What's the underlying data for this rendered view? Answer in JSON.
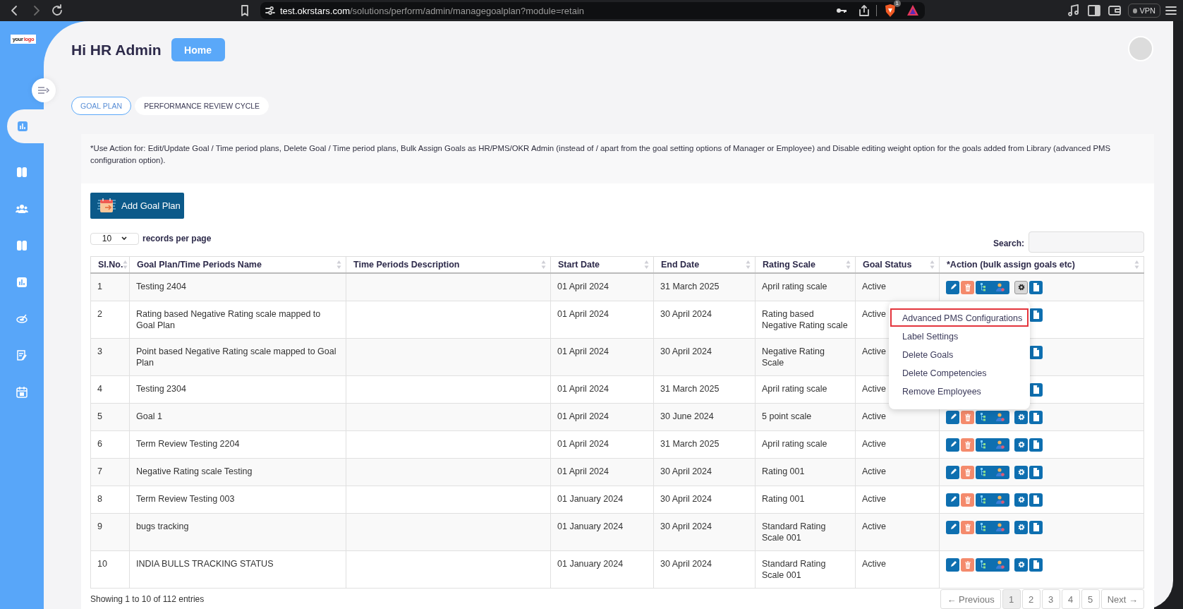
{
  "browser": {
    "url_host": "test.okrstars.com",
    "url_path": "/solutions/perform/admin/managegoalplan?module=retain",
    "shield_badge": "1",
    "vpn_label": "VPN"
  },
  "sidebar": {
    "logo": [
      "your",
      "logo"
    ],
    "items": [
      {
        "kind": "chart",
        "selected": true
      },
      {
        "kind": "book",
        "selected": false
      },
      {
        "kind": "team",
        "selected": false
      },
      {
        "kind": "book",
        "selected": false
      },
      {
        "kind": "chart",
        "selected": false
      },
      {
        "kind": "target",
        "selected": false
      },
      {
        "kind": "form",
        "selected": false
      },
      {
        "kind": "calendar",
        "selected": false
      }
    ]
  },
  "header": {
    "greeting": "Hi HR Admin",
    "home_button": "Home"
  },
  "tabs": [
    {
      "label": "GOAL PLAN",
      "selected": true
    },
    {
      "label": "PERFORMANCE REVIEW CYCLE",
      "selected": false
    }
  ],
  "note": "*Use Action for: Edit/Update Goal / Time period plans, Delete Goal / Time period plans, Bulk Assign Goals as HR/PMS/OKR Admin (instead of / apart from the goal setting options of Manager or Employee) and Disable editing weight option for the goals added from Library (advanced PMS configuration option).",
  "add_button": "Add Goal Plan",
  "page_size": {
    "value": "10",
    "label": "records per page"
  },
  "search": {
    "label": "Search:"
  },
  "table": {
    "columns": [
      "Sl.No.",
      "Goal Plan/Time Periods Name",
      "Time Periods Description",
      "Start Date",
      "End Date",
      "Rating Scale",
      "Goal Status",
      "*Action (bulk assign goals etc)"
    ],
    "rows": [
      {
        "no": "1",
        "name": "Testing 2404",
        "start_date": "01 April 2024",
        "end_date": "31 March 2025",
        "rating_scale": "April rating scale",
        "status": "Active",
        "actions": [
          {
            "kind": "edit"
          },
          {
            "kind": "delete"
          },
          {
            "kind": "assign"
          },
          {
            "kind": "settings",
            "expanded": true
          },
          {
            "kind": "document"
          }
        ]
      },
      {
        "no": "2",
        "name": "Rating based Negative Rating scale mapped to Goal Plan",
        "start_date": "01 April 2024",
        "end_date": "30 April 2024",
        "rating_scale": "Rating based Negative Rating scale",
        "status": "Active",
        "actions": [
          {
            "kind": "document"
          }
        ]
      },
      {
        "no": "3",
        "name": "Point based Negative Rating scale mapped to Goal Plan",
        "start_date": "01 April 2024",
        "end_date": "30 April 2024",
        "rating_scale": "Negative Rating Scale",
        "status": "Active",
        "actions": [
          {
            "kind": "document"
          }
        ]
      },
      {
        "no": "4",
        "name": "Testing 2304",
        "start_date": "01 April 2024",
        "end_date": "31 March 2025",
        "rating_scale": "April rating scale",
        "status": "Active",
        "actions": [
          {
            "kind": "document"
          }
        ]
      },
      {
        "no": "5",
        "name": "Goal 1",
        "start_date": "01 April 2024",
        "end_date": "30 June 2024",
        "rating_scale": "5 point scale",
        "status": "Active",
        "actions": [
          {
            "kind": "edit"
          },
          {
            "kind": "delete"
          },
          {
            "kind": "assign"
          },
          {
            "kind": "settings",
            "expanded": false
          },
          {
            "kind": "document"
          }
        ]
      },
      {
        "no": "6",
        "name": "Term Review Testing 2204",
        "start_date": "01 April 2024",
        "end_date": "31 March 2025",
        "rating_scale": "April rating scale",
        "status": "Active",
        "actions": [
          {
            "kind": "edit"
          },
          {
            "kind": "delete"
          },
          {
            "kind": "assign"
          },
          {
            "kind": "settings",
            "expanded": false
          },
          {
            "kind": "document"
          }
        ]
      },
      {
        "no": "7",
        "name": "Negative Rating scale Testing",
        "start_date": "01 April 2024",
        "end_date": "30 April 2024",
        "rating_scale": "Rating 001",
        "status": "Active",
        "actions": [
          {
            "kind": "edit"
          },
          {
            "kind": "delete"
          },
          {
            "kind": "assign"
          },
          {
            "kind": "settings",
            "expanded": false
          },
          {
            "kind": "document"
          }
        ]
      },
      {
        "no": "8",
        "name": "Term Review Testing 003",
        "start_date": "01 January 2024",
        "end_date": "30 April 2024",
        "rating_scale": "Rating 001",
        "status": "Active",
        "actions": [
          {
            "kind": "edit"
          },
          {
            "kind": "delete"
          },
          {
            "kind": "assign"
          },
          {
            "kind": "settings",
            "expanded": false
          },
          {
            "kind": "document"
          }
        ]
      },
      {
        "no": "9",
        "name": "bugs tracking",
        "start_date": "01 January 2024",
        "end_date": "30 April 2024",
        "rating_scale": "Standard Rating Scale 001",
        "status": "Active",
        "actions": [
          {
            "kind": "edit"
          },
          {
            "kind": "delete"
          },
          {
            "kind": "assign"
          },
          {
            "kind": "settings",
            "expanded": false
          },
          {
            "kind": "document"
          }
        ]
      },
      {
        "no": "10",
        "name": "INDIA BULLS TRACKING STATUS",
        "start_date": "01 January 2024",
        "end_date": "30 April 2024",
        "rating_scale": "Standard Rating Scale 001",
        "status": "Active",
        "actions": [
          {
            "kind": "edit"
          },
          {
            "kind": "delete"
          },
          {
            "kind": "assign"
          },
          {
            "kind": "settings",
            "expanded": false
          },
          {
            "kind": "document"
          }
        ]
      }
    ]
  },
  "menu": {
    "items": [
      {
        "label": "Advanced PMS Configurations",
        "selected": true
      },
      {
        "label": "Label Settings",
        "selected": false
      },
      {
        "label": "Delete Goals",
        "selected": false
      },
      {
        "label": "Delete Competencies",
        "selected": false
      },
      {
        "label": "Remove Employees",
        "selected": false
      }
    ]
  },
  "footer": {
    "info": "Showing 1 to 10 of 112 entries",
    "pages": [
      {
        "label": "← Previous",
        "selected": false
      },
      {
        "label": "1",
        "selected": true
      },
      {
        "label": "2",
        "selected": false
      },
      {
        "label": "3",
        "selected": false
      },
      {
        "label": "4",
        "selected": false
      },
      {
        "label": "5",
        "selected": false
      },
      {
        "label": "Next →",
        "selected": false
      }
    ]
  }
}
